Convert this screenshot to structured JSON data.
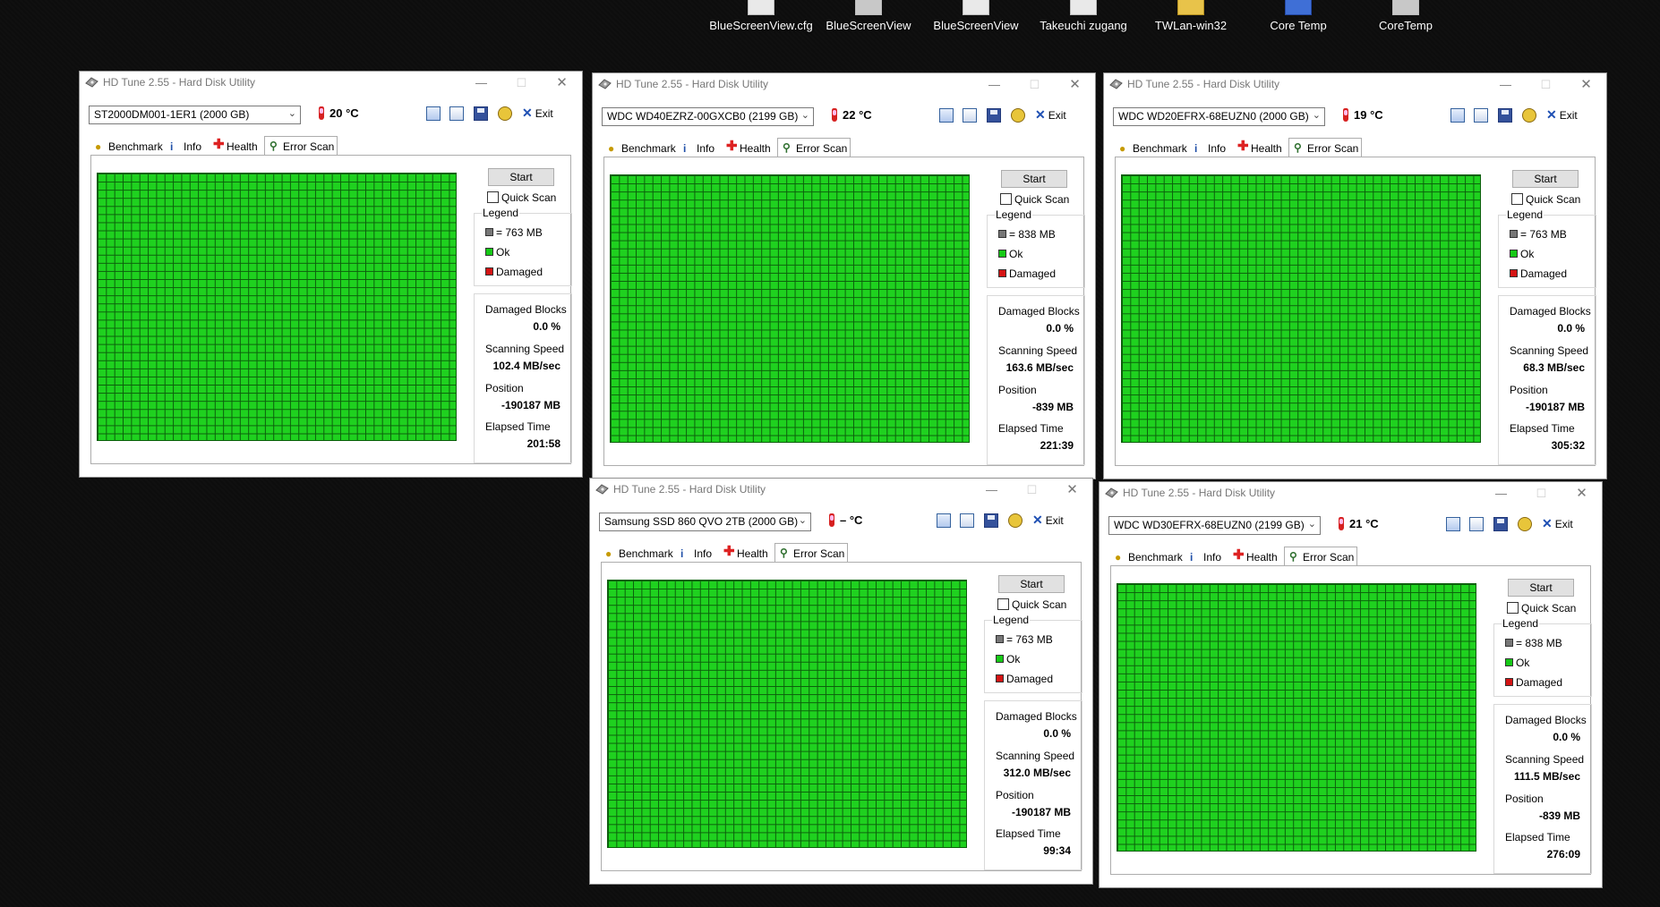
{
  "desktop": {
    "icons": [
      {
        "label": "BlueScreenView.cfg",
        "icon": "file-icon"
      },
      {
        "label": "BlueScreenView",
        "icon": "bluescreenview-icon"
      },
      {
        "label": "BlueScreenView",
        "icon": "file-icon"
      },
      {
        "label": "Takeuchi zugang",
        "icon": "file-icon"
      },
      {
        "label": "TWLan-win32",
        "icon": "folder-icon"
      },
      {
        "label": "Core Temp",
        "icon": "coretemp-icon"
      },
      {
        "label": "CoreTemp",
        "icon": "coretemp-icon"
      }
    ]
  },
  "common": {
    "window_title": "HD Tune 2.55 - Hard Disk Utility",
    "exit_label": "Exit",
    "start_label": "Start",
    "quick_scan_label": "Quick Scan",
    "legend_title": "Legend",
    "legend_ok": "Ok",
    "legend_damaged": "Damaged",
    "damaged_blocks_label": "Damaged Blocks",
    "scanning_speed_label": "Scanning Speed",
    "position_label": "Position",
    "elapsed_time_label": "Elapsed Time",
    "tabs": {
      "benchmark": "Benchmark",
      "info": "Info",
      "health": "Health",
      "error_scan": "Error Scan"
    },
    "colors": {
      "ok_block": "#1fd11f",
      "damaged_block": "#d41414",
      "grid_line": "#0c5f0c",
      "exit_icon": "#1e4fb3"
    }
  },
  "windows": [
    {
      "drive": "ST2000DM001-1ER1 (2000 GB)",
      "temperature": "20 °C",
      "legend_block": "= 763 MB",
      "damaged_blocks": "0.0 %",
      "scanning_speed": "102.4 MB/sec",
      "position": "-190187 MB",
      "elapsed_time": "201:58",
      "active_tab": "Error Scan"
    },
    {
      "drive": "WDC    WD40EZRZ-00GXCB0 (2199 GB)",
      "temperature": "22 °C",
      "legend_block": "= 838 MB",
      "damaged_blocks": "0.0 %",
      "scanning_speed": "163.6 MB/sec",
      "position": "-839 MB",
      "elapsed_time": "221:39",
      "active_tab": "Error Scan"
    },
    {
      "drive": "WDC    WD20EFRX-68EUZN0 (2000 GB)",
      "temperature": "19 °C",
      "legend_block": "= 763 MB",
      "damaged_blocks": "0.0 %",
      "scanning_speed": "68.3 MB/sec",
      "position": "-190187 MB",
      "elapsed_time": "305:32",
      "active_tab": "Error Scan"
    },
    {
      "drive": "Samsung SSD 860 QVO 2TB (2000 GB)",
      "temperature": "– °C",
      "legend_block": "= 763 MB",
      "damaged_blocks": "0.0 %",
      "scanning_speed": "312.0 MB/sec",
      "position": "-190187 MB",
      "elapsed_time": "99:34",
      "active_tab": "Error Scan"
    },
    {
      "drive": "WDC    WD30EFRX-68EUZN0 (2199 GB)",
      "temperature": "21 °C",
      "legend_block": "= 838 MB",
      "damaged_blocks": "0.0 %",
      "scanning_speed": "111.5 MB/sec",
      "position": "-839 MB",
      "elapsed_time": "276:09",
      "active_tab": "Error Scan"
    }
  ]
}
